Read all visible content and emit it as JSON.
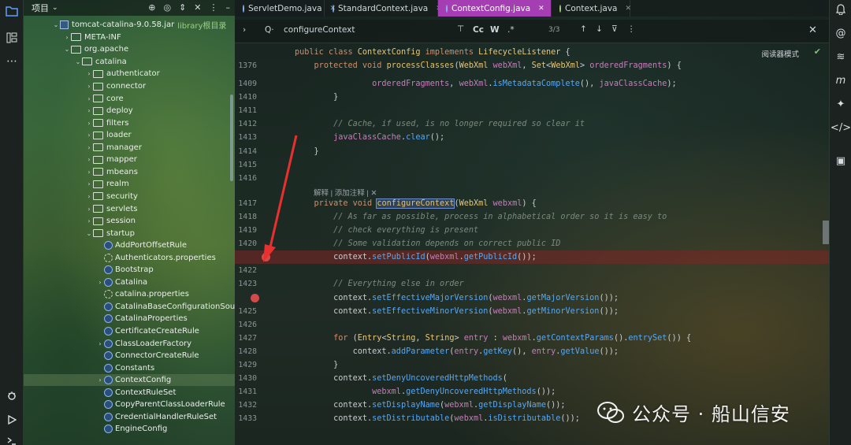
{
  "project_panel": {
    "title": "项目",
    "tree": [
      {
        "label": "tomcat-catalina-9.0.58.jar",
        "extra": "library根目录",
        "type": "jar",
        "arrow": "⌄",
        "indent": 0
      },
      {
        "label": "META-INF",
        "type": "folder",
        "arrow": "›",
        "indent": 1
      },
      {
        "label": "org.apache",
        "type": "folder",
        "arrow": "⌄",
        "indent": 1
      },
      {
        "label": "catalina",
        "type": "folder",
        "arrow": "⌄",
        "indent": 2
      },
      {
        "label": "authenticator",
        "type": "folder",
        "arrow": "›",
        "indent": 3
      },
      {
        "label": "connector",
        "type": "folder",
        "arrow": "›",
        "indent": 3
      },
      {
        "label": "core",
        "type": "folder",
        "arrow": "›",
        "indent": 3
      },
      {
        "label": "deploy",
        "type": "folder",
        "arrow": "›",
        "indent": 3
      },
      {
        "label": "filters",
        "type": "folder",
        "arrow": "›",
        "indent": 3
      },
      {
        "label": "loader",
        "type": "folder",
        "arrow": "›",
        "indent": 3
      },
      {
        "label": "manager",
        "type": "folder",
        "arrow": "›",
        "indent": 3
      },
      {
        "label": "mapper",
        "type": "folder",
        "arrow": "›",
        "indent": 3
      },
      {
        "label": "mbeans",
        "type": "folder",
        "arrow": "›",
        "indent": 3
      },
      {
        "label": "realm",
        "type": "folder",
        "arrow": "›",
        "indent": 3
      },
      {
        "label": "security",
        "type": "folder",
        "arrow": "›",
        "indent": 3
      },
      {
        "label": "servlets",
        "type": "folder",
        "arrow": "›",
        "indent": 3
      },
      {
        "label": "session",
        "type": "folder",
        "arrow": "›",
        "indent": 3
      },
      {
        "label": "startup",
        "type": "folder",
        "arrow": "⌄",
        "indent": 3
      },
      {
        "label": "AddPortOffsetRule",
        "type": "class",
        "arrow": "",
        "indent": 4
      },
      {
        "label": "Authenticators.properties",
        "type": "prop",
        "arrow": "",
        "indent": 4
      },
      {
        "label": "Bootstrap",
        "type": "class",
        "arrow": "",
        "indent": 4
      },
      {
        "label": "Catalina",
        "type": "class",
        "arrow": "›",
        "indent": 4
      },
      {
        "label": "catalina.properties",
        "type": "prop",
        "arrow": "",
        "indent": 4
      },
      {
        "label": "CatalinaBaseConfigurationSource",
        "type": "class",
        "arrow": "",
        "indent": 4
      },
      {
        "label": "CatalinaProperties",
        "type": "class",
        "arrow": "",
        "indent": 4
      },
      {
        "label": "CertificateCreateRule",
        "type": "class",
        "arrow": "",
        "indent": 4
      },
      {
        "label": "ClassLoaderFactory",
        "type": "class",
        "arrow": "›",
        "indent": 4
      },
      {
        "label": "ConnectorCreateRule",
        "type": "class",
        "arrow": "",
        "indent": 4
      },
      {
        "label": "Constants",
        "type": "class",
        "arrow": "",
        "indent": 4
      },
      {
        "label": "ContextConfig",
        "type": "class",
        "arrow": "›",
        "indent": 4,
        "selected": true
      },
      {
        "label": "ContextRuleSet",
        "type": "class",
        "arrow": "",
        "indent": 4
      },
      {
        "label": "CopyParentClassLoaderRule",
        "type": "class",
        "arrow": "",
        "indent": 4
      },
      {
        "label": "CredentialHandlerRuleSet",
        "type": "class",
        "arrow": "",
        "indent": 4
      },
      {
        "label": "EngineConfig",
        "type": "class",
        "arrow": "",
        "indent": 4
      }
    ]
  },
  "tabs": [
    {
      "label": "ServletDemo.java",
      "active": false,
      "kind": "class"
    },
    {
      "label": "StandardContext.java",
      "active": false,
      "kind": "class"
    },
    {
      "label": "ContextConfig.java",
      "active": true,
      "kind": "class"
    },
    {
      "label": "Context.java",
      "active": false,
      "kind": "iface"
    }
  ],
  "find": {
    "query": "configureContext",
    "match_count": "3/3",
    "options": {
      "case": "Cc",
      "word": "W",
      "regex": ".*"
    }
  },
  "editor": {
    "reader_mode": "阅读器模式",
    "inlay_hint": "解释 | 添加注释 | ✕",
    "sticky": [
      {
        "ln": "",
        "code": "public class ContextConfig implements LifecycleListener {"
      },
      {
        "ln": "1376",
        "code": "    protected void processClasses(WebXml webXml, Set<WebXml> orderedFragments) {"
      }
    ],
    "lines": [
      {
        "ln": "1409",
        "code": "                orderedFragments, webXml.isMetadataComplete(), javaClassCache);"
      },
      {
        "ln": "1410",
        "code": "        }"
      },
      {
        "ln": "1411",
        "code": ""
      },
      {
        "ln": "1412",
        "code": "        // Cache, if used, is no longer required so clear it"
      },
      {
        "ln": "1413",
        "code": "        javaClassCache.clear();"
      },
      {
        "ln": "1414",
        "code": "    }"
      },
      {
        "ln": "1415",
        "code": ""
      },
      {
        "ln": "1416",
        "code": ""
      },
      {
        "ln": "1417",
        "code": "    private void configureContext(WebXml webxml) {"
      },
      {
        "ln": "1418",
        "code": "        // As far as possible, process in alphabetical order so it is easy to"
      },
      {
        "ln": "1419",
        "code": "        // check everything is present"
      },
      {
        "ln": "1420",
        "code": "        // Some validation depends on correct public ID"
      },
      {
        "ln": "",
        "code": "        context.setPublicId(webxml.getPublicId());"
      },
      {
        "ln": "1422",
        "code": ""
      },
      {
        "ln": "1423",
        "code": "        // Everything else in order"
      },
      {
        "ln": "",
        "code": "        context.setEffectiveMajorVersion(webxml.getMajorVersion());"
      },
      {
        "ln": "1425",
        "code": "        context.setEffectiveMinorVersion(webxml.getMinorVersion());"
      },
      {
        "ln": "1426",
        "code": ""
      },
      {
        "ln": "1427",
        "code": "        for (Entry<String, String> entry : webxml.getContextParams().entrySet()) {"
      },
      {
        "ln": "1428",
        "code": "            context.addParameter(entry.getKey(), entry.getValue());"
      },
      {
        "ln": "1429",
        "code": "        }"
      },
      {
        "ln": "1430",
        "code": "        context.setDenyUncoveredHttpMethods("
      },
      {
        "ln": "1431",
        "code": "                webxml.getDenyUncoveredHttpMethods());"
      },
      {
        "ln": "1432",
        "code": "        context.setDisplayName(webxml.getDisplayName());"
      },
      {
        "ln": "1433",
        "code": "        context.setDistributable(webxml.isDistributable());"
      }
    ]
  },
  "watermark": "公众号 · 船山信安",
  "colors": {
    "active_tab": "#a53db3",
    "breakpoint": "#d34a4a",
    "breakpoint_line": "#802424",
    "arrow": "#e8312f"
  }
}
